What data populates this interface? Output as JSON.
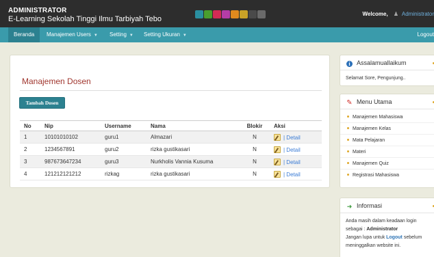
{
  "header": {
    "title": "ADMINISTRATOR",
    "subtitle": "E-Learning Sekolah Tinggi Ilmu Tarbiyah Tebo",
    "swatch_colors": [
      "#2a8fa0",
      "#4a9e2e",
      "#d22c55",
      "#b43da6",
      "#e08a1e",
      "#c9a227",
      "#4a4a4a",
      "#6a6a6a"
    ],
    "welcome_label": "Welcome,",
    "user_icon": "user-icon",
    "username": "Administrator"
  },
  "nav": {
    "items": [
      {
        "label": "Beranda"
      },
      {
        "label": "Manajemen Users"
      },
      {
        "label": "Setting"
      },
      {
        "label": "Setting Ukuran"
      }
    ],
    "logout_label": "Logout",
    "caret_icon": "chevron-down-icon"
  },
  "main": {
    "page_title": "Manajemen Dosen",
    "add_button": "Tambah Dosen",
    "table": {
      "headers": [
        "No",
        "Nip",
        "Username",
        "Nama",
        "Blokir",
        "Aksi"
      ],
      "rows": [
        {
          "no": "1",
          "nip": "10101010102",
          "username": "guru1",
          "nama": "Almazari",
          "blokir": "N",
          "detail": "| Detail"
        },
        {
          "no": "2",
          "nip": "1234567891",
          "username": "guru2",
          "nama": "rizka gustikasari",
          "blokir": "N",
          "detail": "| Detail"
        },
        {
          "no": "3",
          "nip": "987673647234",
          "username": "guru3",
          "nama": "Nurkholis Vannia Kusuma",
          "blokir": "N",
          "detail": "| Detail"
        },
        {
          "no": "4",
          "nip": "121212121212",
          "username": "rizkag",
          "nama": "rizka gustikasari",
          "blokir": "N",
          "detail": "| Detail"
        }
      ],
      "edit_icon": "edit-pencil-icon"
    }
  },
  "sidebar": {
    "greeting": {
      "title": "Assalamuallaikum",
      "icon": "info-icon",
      "text": "Selamat Sore, Pengunjung.."
    },
    "menu": {
      "title": "Menu Utama",
      "icon": "pencil-icon",
      "items": [
        "Manajemen Mahasiswa",
        "Manajemen Kelas",
        "Mata Pelajaran",
        "Materi",
        "Manajemen Quiz",
        "Registrasi Mahasiswa"
      ]
    },
    "info": {
      "title": "Informasi",
      "icon": "arrow-right-icon",
      "line1": "Anda masih dalam keadaan login",
      "line2_prefix": "sebagai :",
      "role": "Administrator",
      "line3_prefix": "Jangan lupa untuk",
      "logout_word": "Logout",
      "line3_suffix": "sebelum",
      "line4": "meninggalkan website ini."
    },
    "accent_color": "#e0a92a"
  }
}
